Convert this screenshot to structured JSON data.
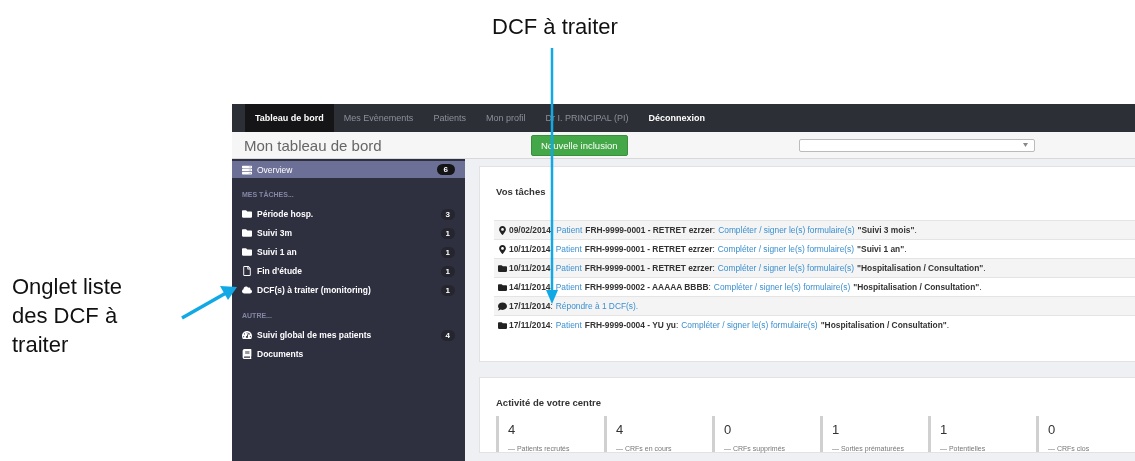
{
  "annotations": {
    "top": "DCF à traiter",
    "left": "Onglet liste des DCF à traiter"
  },
  "navbar": {
    "tabs": [
      {
        "label": "Tableau de bord",
        "selected": true,
        "kind": "nav"
      },
      {
        "label": "Mes Evènements",
        "selected": false,
        "kind": "nav"
      },
      {
        "label": "Patients",
        "selected": false,
        "kind": "nav"
      },
      {
        "label": "Mon profil",
        "selected": false,
        "kind": "nav"
      },
      {
        "label": "Dr I. PRINCIPAL (PI)",
        "selected": false,
        "kind": "nav"
      },
      {
        "label": "Déconnexion",
        "selected": false,
        "kind": "logout"
      }
    ]
  },
  "header": {
    "title": "Mon tableau de bord",
    "button": "Nouvelle inclusion"
  },
  "sidebar": {
    "items": [
      {
        "kind": "item",
        "label": "Overview",
        "badge": "6",
        "selected": true
      },
      {
        "kind": "section",
        "label": "MES TÂCHES..."
      },
      {
        "kind": "item",
        "label": "Période hosp.",
        "badge": "3",
        "selected": false
      },
      {
        "kind": "item",
        "label": "Suivi 3m",
        "badge": "1",
        "selected": false
      },
      {
        "kind": "item",
        "label": "Suivi 1 an",
        "badge": "1",
        "selected": false
      },
      {
        "kind": "item",
        "label": "Fin d'étude",
        "badge": "1",
        "selected": false
      },
      {
        "kind": "item",
        "label": "DCF(s) à traiter (monitoring)",
        "badge": "1",
        "selected": false
      },
      {
        "kind": "section",
        "label": "AUTRE..."
      },
      {
        "kind": "item",
        "label": "Suivi global de mes patients",
        "badge": "4",
        "selected": false
      },
      {
        "kind": "item",
        "label": "Documents",
        "selected": false
      }
    ]
  },
  "tasks": {
    "title": "Vos tâches",
    "rows": [
      {
        "parts": [
          {
            "kind": "bold",
            "text": "09/02/2014"
          },
          {
            "kind": "plain",
            "text": ":"
          },
          {
            "kind": "link",
            "text": "Patient"
          },
          {
            "kind": "bold",
            "text": "FRH-9999-0001 - RETRET ezrzer"
          },
          {
            "kind": "plain",
            "text": ":"
          },
          {
            "kind": "link",
            "text": "Compléter / signer le(s) formulaire(s)"
          },
          {
            "kind": "bold",
            "text": "\"Suivi 3 mois\""
          },
          {
            "kind": "plain",
            "text": "."
          }
        ]
      },
      {
        "parts": [
          {
            "kind": "bold",
            "text": "10/11/2014"
          },
          {
            "kind": "plain",
            "text": ":"
          },
          {
            "kind": "link",
            "text": "Patient"
          },
          {
            "kind": "bold",
            "text": "FRH-9999-0001 - RETRET ezrzer"
          },
          {
            "kind": "plain",
            "text": ":"
          },
          {
            "kind": "link",
            "text": "Compléter / signer le(s) formulaire(s)"
          },
          {
            "kind": "bold",
            "text": "\"Suivi 1 an\""
          },
          {
            "kind": "plain",
            "text": "."
          }
        ]
      },
      {
        "parts": [
          {
            "kind": "bold",
            "text": "10/11/2014"
          },
          {
            "kind": "plain",
            "text": ":"
          },
          {
            "kind": "link",
            "text": "Patient"
          },
          {
            "kind": "bold",
            "text": "FRH-9999-0001 - RETRET ezrzer"
          },
          {
            "kind": "plain",
            "text": ":"
          },
          {
            "kind": "link",
            "text": "Compléter / signer le(s) formulaire(s)"
          },
          {
            "kind": "bold",
            "text": "\"Hospitalisation / Consultation\""
          },
          {
            "kind": "plain",
            "text": "."
          }
        ]
      },
      {
        "parts": [
          {
            "kind": "bold",
            "text": "14/11/2014"
          },
          {
            "kind": "plain",
            "text": ":"
          },
          {
            "kind": "link",
            "text": "Patient"
          },
          {
            "kind": "bold",
            "text": "FRH-9999-0002 - AAAAA BBBB"
          },
          {
            "kind": "plain",
            "text": ":"
          },
          {
            "kind": "link",
            "text": "Compléter / signer le(s) formulaire(s)"
          },
          {
            "kind": "bold",
            "text": "\"Hospitalisation / Consultation\""
          },
          {
            "kind": "plain",
            "text": "."
          }
        ]
      },
      {
        "parts": [
          {
            "kind": "bold",
            "text": "17/11/2014"
          },
          {
            "kind": "plain",
            "text": ":"
          },
          {
            "kind": "link",
            "text": "Répondre à 1 DCF(s)."
          }
        ]
      },
      {
        "parts": [
          {
            "kind": "bold",
            "text": "17/11/2014"
          },
          {
            "kind": "plain",
            "text": ":"
          },
          {
            "kind": "link",
            "text": "Patient"
          },
          {
            "kind": "bold",
            "text": "FRH-9999-0004 - YU yu"
          },
          {
            "kind": "plain",
            "text": ":"
          },
          {
            "kind": "link",
            "text": "Compléter / signer le(s) formulaire(s)"
          },
          {
            "kind": "bold",
            "text": "\"Hospitalisation / Consultation\""
          },
          {
            "kind": "plain",
            "text": "."
          }
        ]
      }
    ]
  },
  "activity": {
    "title": "Activité de votre centre",
    "stats": [
      {
        "value": "4",
        "label": "— Patients recrutés"
      },
      {
        "value": "4",
        "label": "— CRFs en cours"
      },
      {
        "value": "0",
        "label": "— CRFs supprimés"
      },
      {
        "value": "1",
        "label": "— Sorties prématurées"
      },
      {
        "value": "1",
        "label": "— Potentielles"
      },
      {
        "value": "0",
        "label": "— CRFs clos"
      }
    ]
  }
}
